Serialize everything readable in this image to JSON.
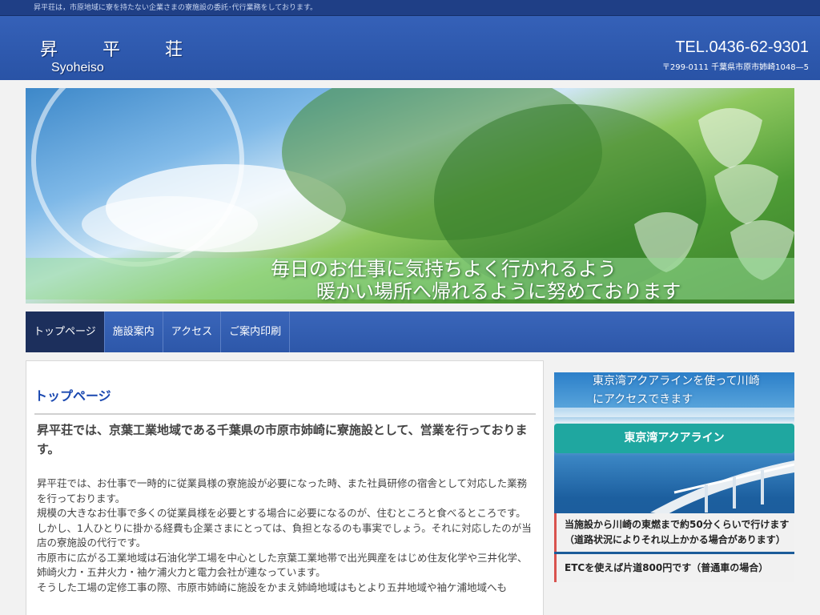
{
  "topbar": {
    "text": "昇平荘は，市原地域に寮を持たない企業さまの寮施設の委託･代行業務をしております。"
  },
  "header": {
    "logo_chars": [
      "昇",
      "平",
      "荘"
    ],
    "logo_roman": "Syoheiso",
    "tel": "TEL.0436-62-9301",
    "address": "〒299-0111 千葉県市原市姉崎1048—5"
  },
  "hero": {
    "line1": "毎日のお仕事に気持ちよく行かれるよう",
    "line2": "暖かい場所へ帰れるように努めております"
  },
  "nav": {
    "items": [
      "トップページ",
      "施設案内",
      "アクセス",
      "ご案内印刷"
    ]
  },
  "main": {
    "title": "トップページ",
    "lead": "昇平荘では、京葉工業地域である千葉県の市原市姉崎に寮施設として、営業を行っております。",
    "paragraphs": [
      "昇平荘では、お仕事で一時的に従業員様の寮施設が必要になった時、また社員研修の宿舎として対応した業務を行っております。",
      "規模の大きなお仕事で多くの従業員様を必要とする場合に必要になるのが、住むところと食べるところです。",
      "しかし、1人ひとりに掛かる経費も企業さまにとっては、負担となるのも事実でしょう。それに対応したのが当店の寮施設の代行です。",
      "市原市に広がる工業地域は石油化学工場を中心とした京葉工業地帯で出光興産をはじめ住友化学や三井化学、姉崎火力・五井火力・袖ケ浦火力と電力会社が連なっています。",
      "そうした工場の定修工事の際、市原市姉崎に施設をかまえ姉崎地域はもとより五井地域や袖ケ浦地域へも"
    ]
  },
  "side": {
    "caption": "東京湾アクアラインを使って川崎にアクセスできます",
    "button": "東京湾アクアライン",
    "note1_line1": "当施設から川崎の東燃まで約50分くらいで行けます",
    "note1_line2": "（道路状況によりそれ以上かかる場合があります）",
    "note2": "ETCを使えば片道800円です（普通車の場合）"
  }
}
